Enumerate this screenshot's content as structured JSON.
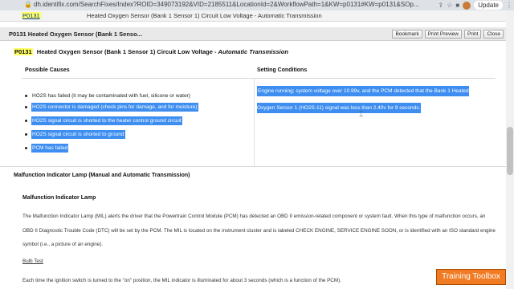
{
  "browser": {
    "url": "dh.identifix.com/SearchFixes/Index?ROID=349073192&VID=2185511&LocationId=2&WorkflowPath=1&KW=p0131#KW=p0131&SOp...",
    "update_label": "Update"
  },
  "top": {
    "code": "P0131",
    "description": "Heated Oxygen Sensor (Bank 1 Sensor 1) Circuit Low Voltage - Automatic Transmission"
  },
  "header": {
    "title": "P0131 Heated Oxygen Sensor (Bank 1 Senso...",
    "buttons": [
      "Bookmark",
      "Print Preview",
      "Print",
      "Close"
    ]
  },
  "dtc": {
    "code": "P0131",
    "title": "Heated Oxygen Sensor (Bank 1 Sensor 1) Circuit Low Voltage - ",
    "title_italic": "Automatic Transmission"
  },
  "table": {
    "causes_header": "Possible Causes",
    "settings_header": "Setting Conditions",
    "causes": [
      "HO2S has failed (it may be contaminated with fuel, silicone or water)",
      "HO2S connector is damaged (check pins for damage, and for moisture)",
      "HO2S signal circuit is shorted to the heater control ground circuit",
      "HO2S signal circuit is shorted to ground",
      "PCM has failed"
    ],
    "causes_selected": [
      false,
      true,
      true,
      true,
      true
    ],
    "setting_text": "Engine running; system voltage over 10.99v, and the PCM detected that the Bank 1 Heated Oxygen Sensor 1 (HO2S-11) signal was less than 2.40v for 9 seconds."
  },
  "mil": {
    "section_title": "Malfunction Indicator Lamp (Manual and Automatic Transmission)",
    "sub_title": "Malfunction Indicator Lamp",
    "paragraph": "The Malfunction Indicator Lamp (MIL) alerts the driver that the Powertrain Control Module (PCM) has detected an OBD II emission-related component or system fault. When this type of malfunction occurs, an OBD II Diagnostic Trouble Code (DTC) will be set by the PCM. The MIL is located on the instrument cluster and is labeled CHECK ENGINE, SERVICE ENGINE SOON, or is identified with an ISO standard engine symbol (i.e., a picture of an engine).",
    "bulb_test": "Bulb Test",
    "paragraph2": "Each time the ignition switch is turned to the \"on\" position, the MIL indicator is illuminated for about 3 seconds (which is a function of the PCM)."
  },
  "badge": "Training Toolbox"
}
